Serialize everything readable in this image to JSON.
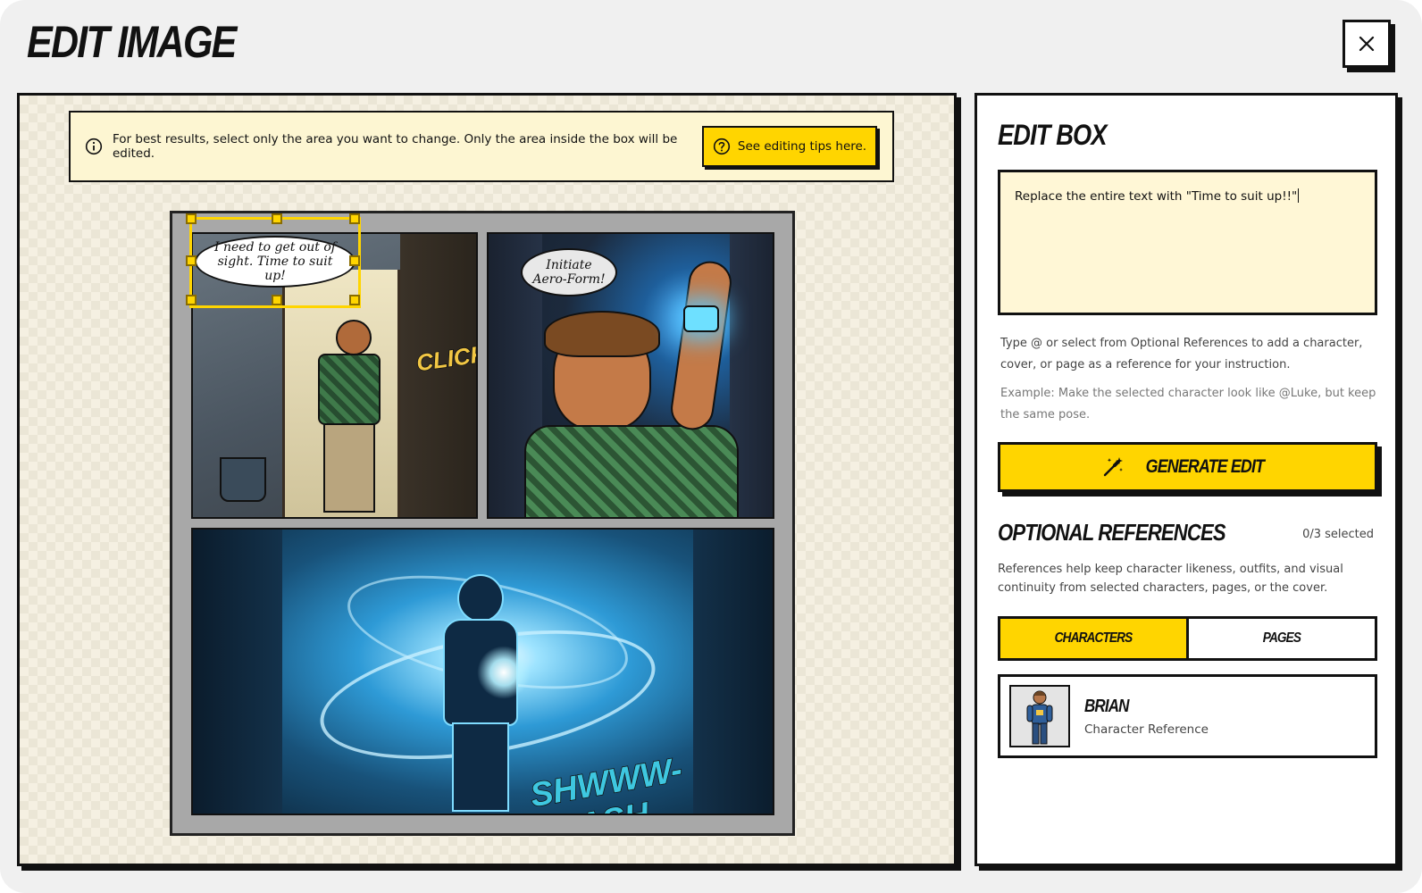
{
  "modal": {
    "title": "EDIT IMAGE",
    "close_icon": "close-icon"
  },
  "canvas": {
    "tip_text": "For best results, select only the area you want to change. Only the area inside the box will be edited.",
    "tip_button": "See editing tips here.",
    "comic": {
      "panel1_bubble": "I need to get out of sight. Time to suit up!",
      "panel1_sfx": "CLICK",
      "panel2_bubble": "Initiate Aero-Form!",
      "panel3_sfx": "SHWWW-FLASH"
    }
  },
  "edit_box": {
    "title": "EDIT BOX",
    "instruction": "Replace the entire text with \"Time to suit up!!\"",
    "help": "Type @ or select from Optional References to add a character, cover, or page as a reference for your instruction.",
    "example": "Example: Make the selected character look like @Luke, but keep the same pose.",
    "generate_label": "GENERATE EDIT"
  },
  "references": {
    "title": "OPTIONAL REFERENCES",
    "count": "0/3 selected",
    "description": "References help keep character likeness, outfits, and visual continuity from selected characters, pages, or the cover.",
    "tabs": [
      {
        "label": "CHARACTERS",
        "active": true
      },
      {
        "label": "PAGES",
        "active": false
      }
    ],
    "items": [
      {
        "name": "BRIAN",
        "subtitle": "Character Reference"
      }
    ]
  },
  "colors": {
    "accent": "#ffd500",
    "ink": "#111111",
    "cream": "#fdf6d2"
  }
}
